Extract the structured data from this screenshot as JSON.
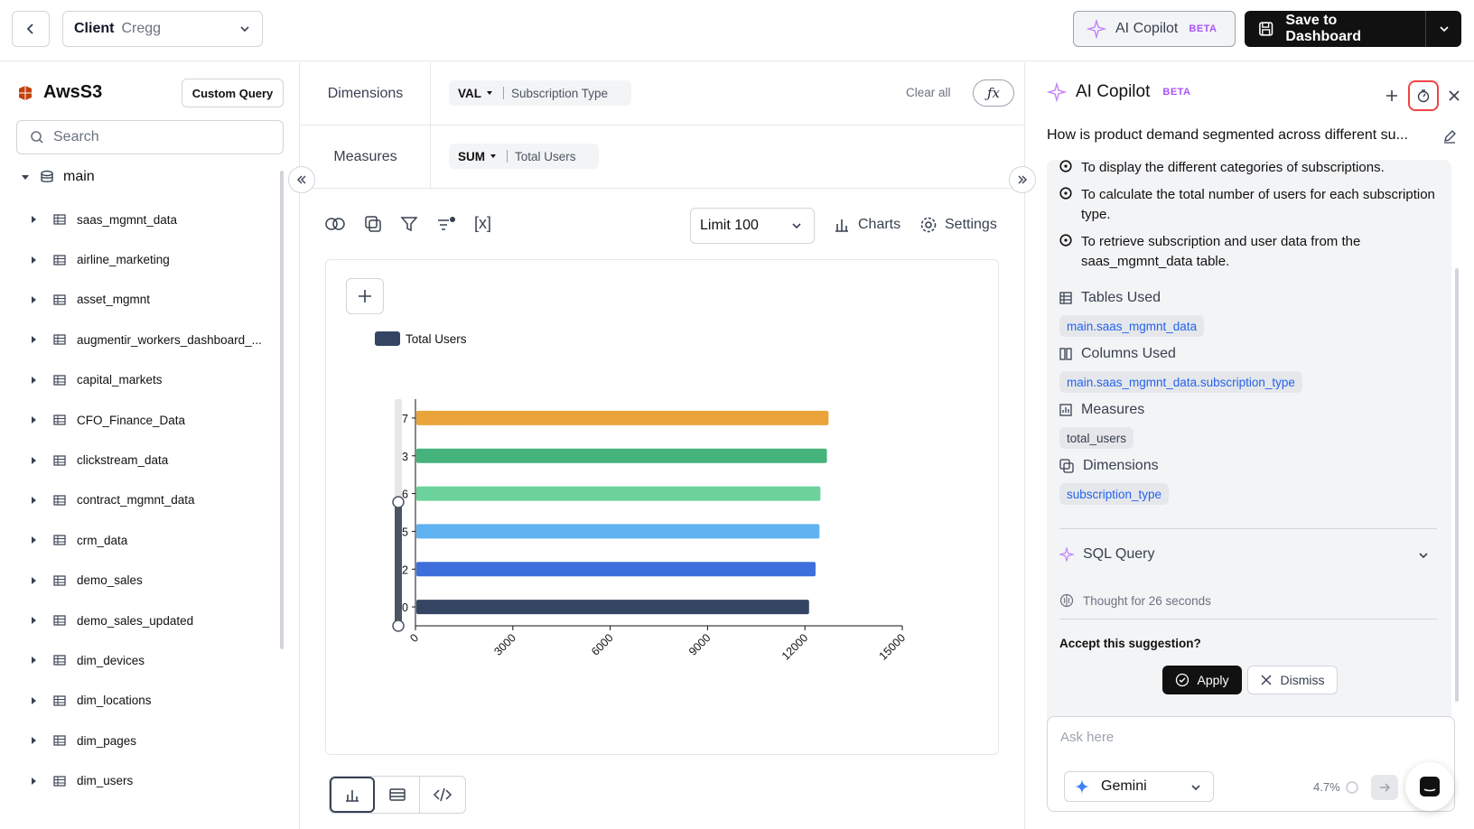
{
  "topbar": {
    "client_label": "Client",
    "client_value": "Cregg",
    "copilot_label": "AI Copilot",
    "copilot_badge": "BETA",
    "save_label": "Save to Dashboard"
  },
  "sidebar": {
    "source_name": "AwsS3",
    "custom_query_label": "Custom Query",
    "search_placeholder": "Search",
    "schema": "main",
    "tables": [
      "saas_mgmnt_data",
      "airline_marketing",
      "asset_mgmnt",
      "augmentir_workers_dashboard_...",
      "capital_markets",
      "CFO_Finance_Data",
      "clickstream_data",
      "contract_mgmnt_data",
      "crm_data",
      "demo_sales",
      "demo_sales_updated",
      "dim_devices",
      "dim_locations",
      "dim_pages",
      "dim_users"
    ]
  },
  "builder": {
    "dimensions_label": "Dimensions",
    "measures_label": "Measures",
    "dim_agg": "VAL",
    "dim_field": "Subscription Type",
    "meas_agg": "SUM",
    "meas_field": "Total Users",
    "clear_all": "Clear all",
    "fx_label": "ƒx",
    "vars_label": "[x]",
    "limit_label": "Limit 100",
    "charts_label": "Charts",
    "settings_label": "Settings"
  },
  "chart_data": {
    "type": "bar",
    "orientation": "horizontal",
    "categories": [
      "7",
      "3",
      "6",
      "5",
      "2",
      "0"
    ],
    "series": [
      {
        "name": "Total Users",
        "values": [
          12700,
          12650,
          12450,
          12420,
          12300,
          12100
        ]
      }
    ],
    "bar_colors": [
      "#eba43a",
      "#45b37c",
      "#6bd39b",
      "#5fb3f0",
      "#3d6fdc",
      "#344563"
    ],
    "legend_color": "#344563",
    "xlim": [
      0,
      15000
    ],
    "xticks": [
      "0",
      "3000",
      "6000",
      "9000",
      "12000",
      "15000"
    ]
  },
  "copilot": {
    "title": "AI Copilot",
    "badge": "BETA",
    "question": "How is product demand segmented across different su...",
    "bullets": [
      "To display the different categories of subscriptions.",
      "To calculate the total number of users for each subscription type.",
      "To retrieve subscription and user data from the saas_mgmnt_data table."
    ],
    "tables_used_label": "Tables Used",
    "tables_used": "main.saas_mgmnt_data",
    "columns_used_label": "Columns Used",
    "columns_used": "main.saas_mgmnt_data.subscription_type",
    "measures_label": "Measures",
    "measures": "total_users",
    "dimensions_label": "Dimensions",
    "dimensions": "subscription_type",
    "sql_label": "SQL Query",
    "thought": "Thought for 26 seconds",
    "accept_prompt": "Accept this suggestion?",
    "apply_label": "Apply",
    "dismiss_label": "Dismiss",
    "ask_placeholder": "Ask here",
    "model": "Gemini",
    "usage": "4.7%"
  }
}
